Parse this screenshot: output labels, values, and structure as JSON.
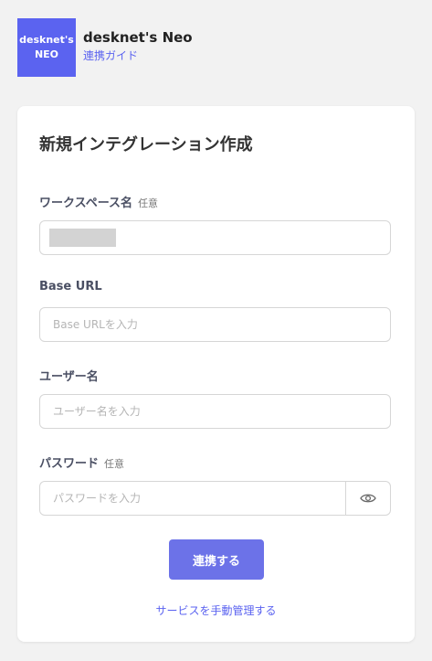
{
  "app": {
    "logo_line1": "desknet's",
    "logo_line2": "NEO",
    "name": "desknet's Neo",
    "guide_link": "連携ガイド",
    "brand_color": "#5b63f0"
  },
  "form": {
    "title": "新規インテグレーション作成",
    "workspace": {
      "label": "ワークスペース名",
      "optional": "任意",
      "value": ""
    },
    "base_url": {
      "label": "Base URL",
      "placeholder": "Base URLを入力"
    },
    "username": {
      "label": "ユーザー名",
      "placeholder": "ユーザー名を入力"
    },
    "password": {
      "label": "パスワード",
      "optional": "任意",
      "placeholder": "パスワードを入力",
      "toggle_icon": "eye-icon"
    },
    "submit_label": "連携する",
    "manage_link": "サービスを手動管理する",
    "accent_color": "#6c72e8"
  }
}
